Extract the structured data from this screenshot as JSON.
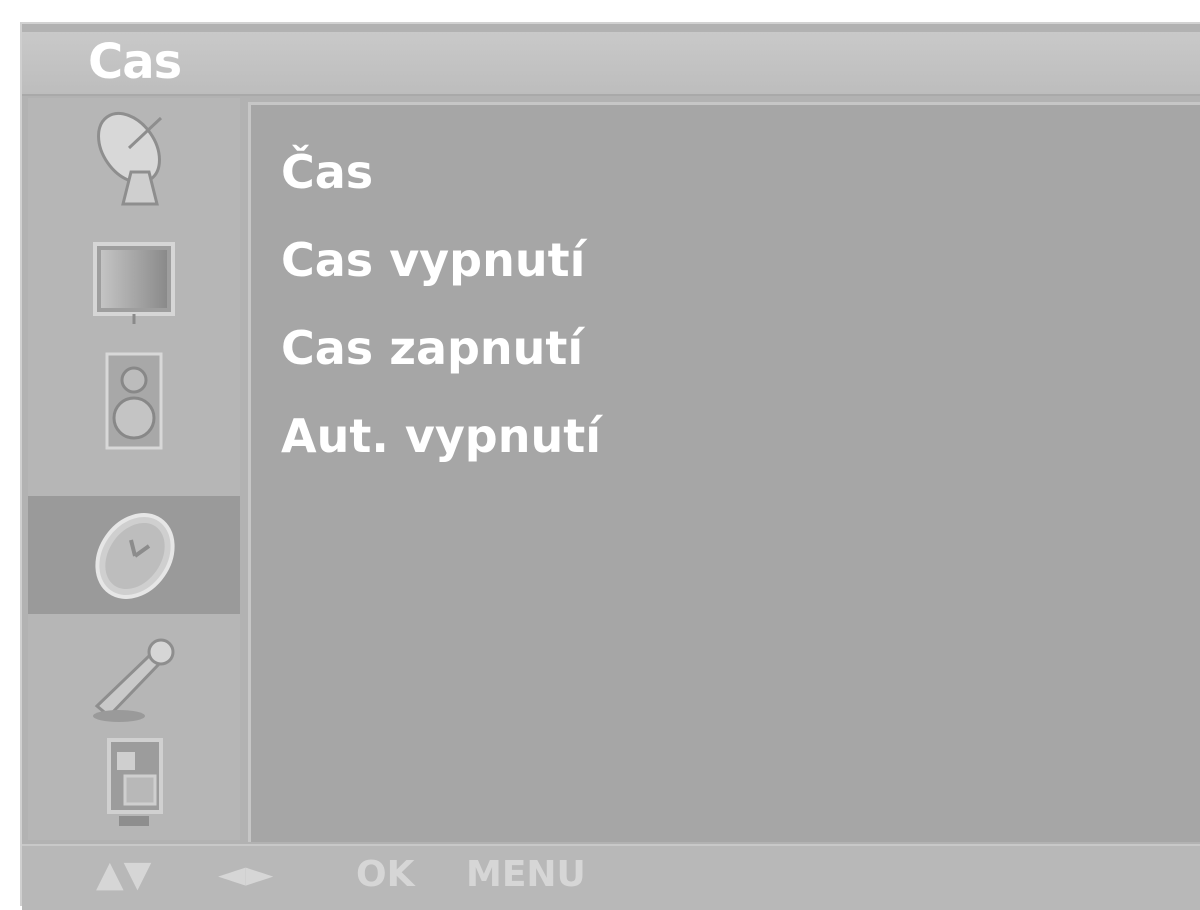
{
  "window": {
    "title": "Cas"
  },
  "sidebar": {
    "items": [
      {
        "icon": "satellite-dish-icon",
        "active": false
      },
      {
        "icon": "picture-screen-icon",
        "active": false
      },
      {
        "icon": "speaker-icon",
        "active": false
      },
      {
        "icon": "clock-icon",
        "active": true
      },
      {
        "icon": "wrench-icon",
        "active": false
      },
      {
        "icon": "input-source-icon",
        "active": false
      }
    ]
  },
  "menu": {
    "items": [
      {
        "label": "Čas"
      },
      {
        "label": "Cas vypnutí"
      },
      {
        "label": "Cas zapnutí"
      },
      {
        "label": "Aut. vypnutí"
      }
    ]
  },
  "footer": {
    "updown": "▲▼",
    "leftright": "◄►",
    "ok": "OK",
    "menu": "MENU"
  }
}
